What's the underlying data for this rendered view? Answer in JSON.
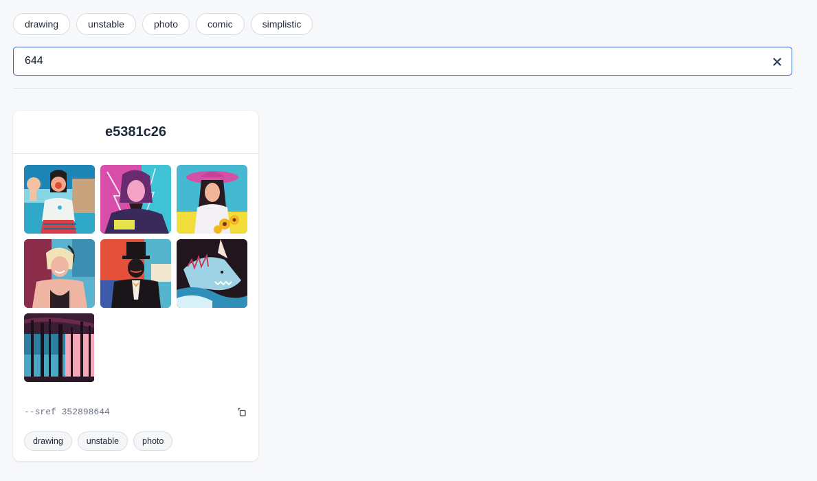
{
  "filters": [
    "drawing",
    "unstable",
    "photo",
    "comic",
    "simplistic"
  ],
  "search": {
    "value": "644",
    "placeholder": ""
  },
  "icons": {
    "clear": "close-icon",
    "copy": "copy-icon"
  },
  "card": {
    "title": "e5381c26",
    "images": [
      "woman-waving-beach",
      "woman-lightning-portrait",
      "woman-hat-sunflowers",
      "smiling-blonde-woman",
      "man-top-hat",
      "white-monster-waves",
      "forest-trees-sunset"
    ],
    "sref": "--sref 352898644",
    "tags": [
      "drawing",
      "unstable",
      "photo"
    ]
  },
  "colors": {
    "accent": "#3b64c8",
    "background": "#f7f8fa"
  }
}
